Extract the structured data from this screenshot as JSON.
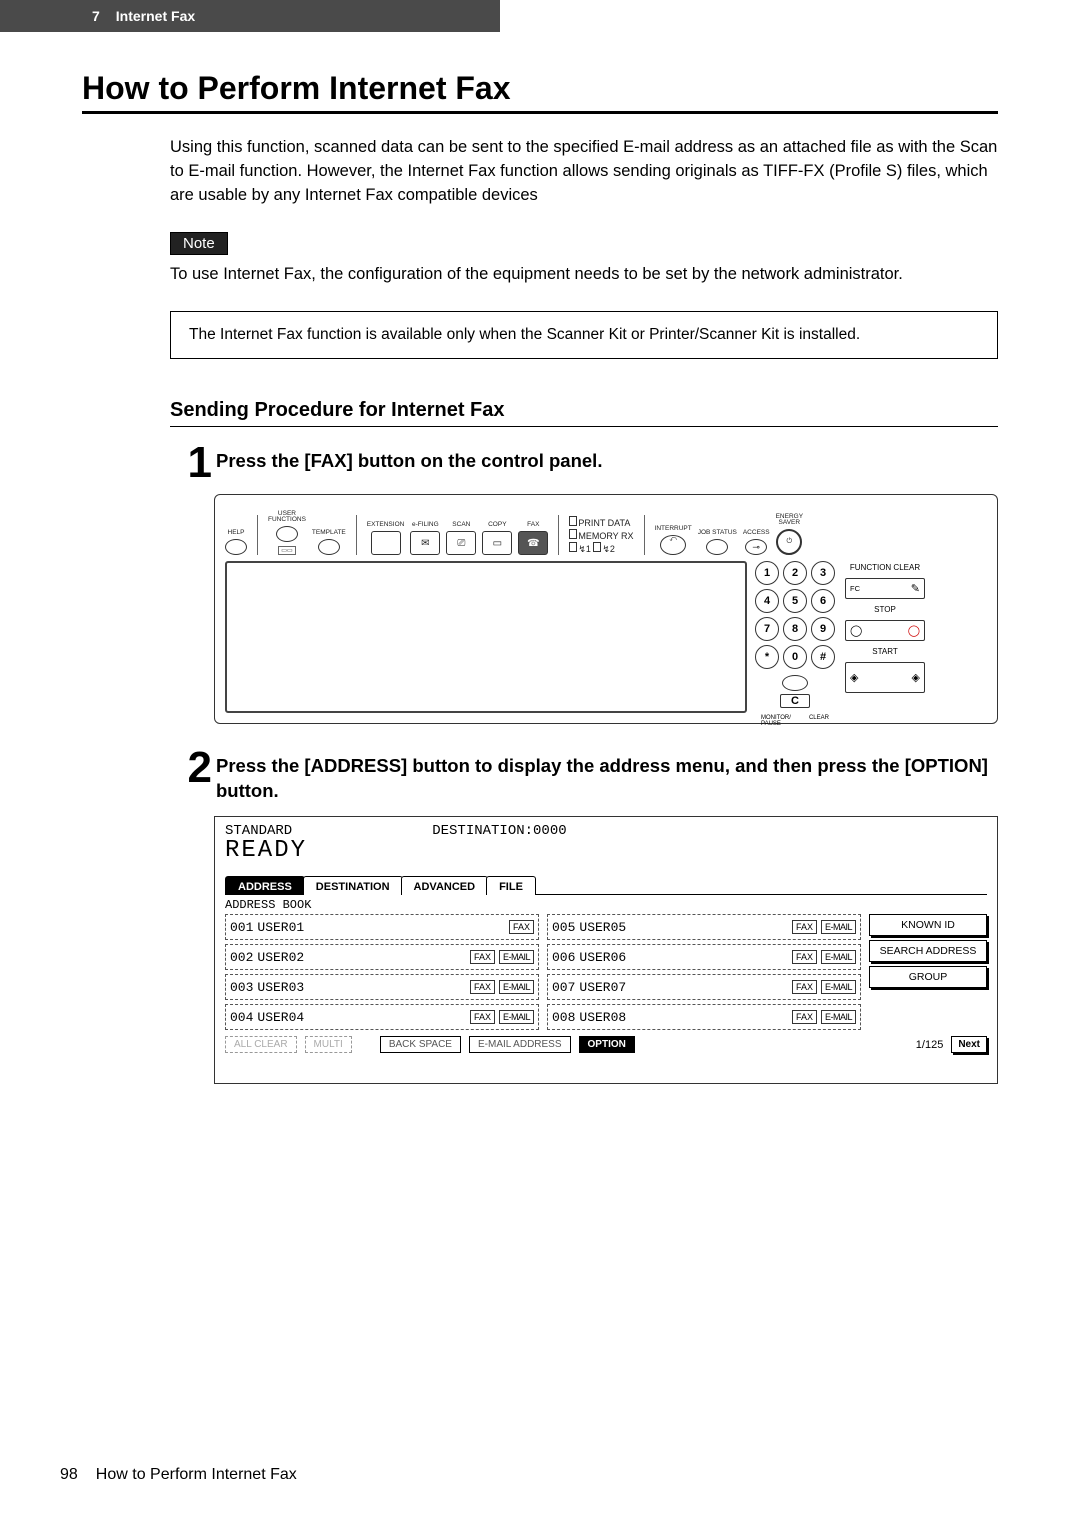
{
  "header": {
    "chapter_num": "7",
    "chapter_title": "Internet Fax"
  },
  "h1": "How to Perform Internet Fax",
  "intro": "Using this function, scanned data can be sent to the specified E-mail address as an attached file as with the Scan to E-mail function.  However, the Internet Fax function allows sending originals as TIFF-FX (Profile S) files, which are usable by any Internet Fax compatible devices",
  "note_label": "Note",
  "note_body": "To use Internet Fax, the configuration of the equipment needs to be set by the network administrator.",
  "callout": "The Internet Fax function is available only when the Scanner Kit or Printer/Scanner Kit is installed.",
  "h2": "Sending Procedure for Internet Fax",
  "steps": [
    {
      "num": "1",
      "text": "Press the [FAX] button on the control panel."
    },
    {
      "num": "2",
      "text": "Press the [ADDRESS] button to display the address menu, and then press the [OPTION] button."
    }
  ],
  "panel": {
    "top_labels": {
      "help": "HELP",
      "user_functions": "USER\nFUNCTIONS",
      "template": "TEMPLATE",
      "extension": "EXTENSION",
      "efiling": "e-FILING",
      "scan": "SCAN",
      "copy": "COPY",
      "fax": "FAX",
      "print_data": "PRINT DATA",
      "memory_rx": "MEMORY RX",
      "interrupt": "INTERRUPT",
      "job_status": "JOB STATUS",
      "access": "ACCESS",
      "energy_saver": "ENERGY\nSAVER"
    },
    "right_buttons": {
      "function_clear": "FUNCTION CLEAR",
      "fc": "FC",
      "stop": "STOP",
      "start": "START"
    },
    "keypad": {
      "digits": [
        "1",
        "2",
        "3",
        "4",
        "5",
        "6",
        "7",
        "8",
        "9",
        "*",
        "0",
        "#"
      ],
      "c": "C",
      "monitor_pause": "MONITOR/\nPAUSE",
      "clear": "CLEAR"
    }
  },
  "addr": {
    "mode": "STANDARD",
    "dest_counter": "DESTINATION:0000",
    "ready": "READY",
    "tabs": [
      "ADDRESS",
      "DESTINATION",
      "ADVANCED",
      "FILE"
    ],
    "sub": "ADDRESS BOOK",
    "rows_left": [
      {
        "id": "001",
        "name": "USER01",
        "fax": true,
        "email": false
      },
      {
        "id": "002",
        "name": "USER02",
        "fax": true,
        "email": true
      },
      {
        "id": "003",
        "name": "USER03",
        "fax": true,
        "email": true
      },
      {
        "id": "004",
        "name": "USER04",
        "fax": true,
        "email": true
      }
    ],
    "rows_right": [
      {
        "id": "005",
        "name": "USER05",
        "fax": true,
        "email": true
      },
      {
        "id": "006",
        "name": "USER06",
        "fax": true,
        "email": true
      },
      {
        "id": "007",
        "name": "USER07",
        "fax": true,
        "email": true
      },
      {
        "id": "008",
        "name": "USER08",
        "fax": true,
        "email": true
      }
    ],
    "side_buttons": [
      "KNOWN ID",
      "SEARCH ADDRESS",
      "GROUP"
    ],
    "foot": {
      "all_clear": "ALL CLEAR",
      "multi": "MULTI",
      "backspace": "BACK SPACE",
      "email_address": "E-MAIL ADDRESS",
      "option": "OPTION",
      "page": "1/125",
      "next": "Next"
    },
    "pill_fax": "FAX",
    "pill_email": "E-MAIL"
  },
  "footer": {
    "page_num": "98",
    "title": "How to Perform Internet Fax"
  }
}
